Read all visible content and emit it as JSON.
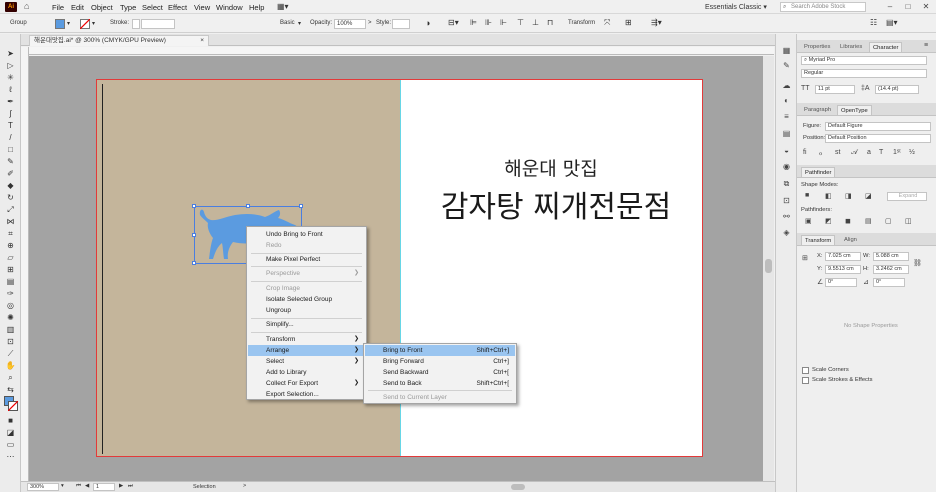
{
  "menubar": {
    "logo": "Ai",
    "items": [
      "File",
      "Edit",
      "Object",
      "Type",
      "Select",
      "Effect",
      "View",
      "Window",
      "Help"
    ],
    "workspace": "Essentials Classic",
    "stock_search_placeholder": "Search Adobe Stock"
  },
  "control_bar": {
    "selection_label": "Group",
    "stroke_label": "Stroke:",
    "brush_label": "Basic",
    "opacity_label": "Opacity:",
    "opacity_value": "100%",
    "style_label": "Style:",
    "transform_label": "Transform"
  },
  "document_tab": {
    "title": "해운대맛집.ai* @ 300% (CMYK/GPU Preview)",
    "close": "×"
  },
  "artwork": {
    "title_small": "해운대 맛집",
    "title_large": "감자탕 찌개전문점"
  },
  "colors": {
    "left_page": "#c4b59b",
    "bull": "#5b9be0",
    "guide": "#67d6e6",
    "artboard_border": "#e23a3a",
    "menu_highlight": "#9ac5f0"
  },
  "context_menu": {
    "items": [
      {
        "label": "Undo Bring to Front",
        "enabled": true
      },
      {
        "label": "Redo",
        "enabled": false
      },
      {
        "label": "Make Pixel Perfect",
        "enabled": true
      },
      {
        "label": "Perspective",
        "enabled": false,
        "submenu": true
      },
      {
        "label": "Crop Image",
        "enabled": false
      },
      {
        "label": "Isolate Selected Group",
        "enabled": true
      },
      {
        "label": "Ungroup",
        "enabled": true
      },
      {
        "label": "Simplify...",
        "enabled": true
      },
      {
        "label": "Transform",
        "enabled": true,
        "submenu": true
      },
      {
        "label": "Arrange",
        "enabled": true,
        "submenu": true,
        "highlighted": true
      },
      {
        "label": "Select",
        "enabled": true,
        "submenu": true
      },
      {
        "label": "Add to Library",
        "enabled": true
      },
      {
        "label": "Collect For Export",
        "enabled": true,
        "submenu": true
      },
      {
        "label": "Export Selection...",
        "enabled": true
      }
    ]
  },
  "arrange_submenu": {
    "items": [
      {
        "label": "Bring to Front",
        "shortcut": "Shift+Ctrl+]",
        "highlighted": true
      },
      {
        "label": "Bring Forward",
        "shortcut": "Ctrl+]"
      },
      {
        "label": "Send Backward",
        "shortcut": "Ctrl+["
      },
      {
        "label": "Send to Back",
        "shortcut": "Shift+Ctrl+["
      },
      {
        "label": "Send to Current Layer",
        "shortcut": "",
        "enabled": false
      }
    ]
  },
  "status_bar": {
    "zoom": "300%",
    "artboard_num": "1",
    "tool_name": "Selection"
  },
  "panels": {
    "top_tabs": [
      "Properties",
      "Libraries",
      "Character"
    ],
    "font_family": "Myriad Pro",
    "font_style": "Regular",
    "font_size": "11 pt",
    "leading": "(14.4 pt)",
    "mid_tabs": [
      "Paragraph",
      "OpenType"
    ],
    "figure_label": "Figure:",
    "figure_value": "Default Figure",
    "position_label": "Position:",
    "position_value": "Default Position",
    "pathfinder_tab": "Pathfinder",
    "shape_modes_label": "Shape Modes:",
    "expand_label": "Expand",
    "pathfinders_label": "Pathfinders:",
    "transform_tabs": [
      "Transform",
      "Align"
    ],
    "x_label": "X:",
    "x_value": "7.025 cm",
    "y_label": "Y:",
    "y_value": "9.5513 cm",
    "w_label": "W:",
    "w_value": "5.088 cm",
    "h_label": "H:",
    "h_value": "3.2462 cm",
    "angle_value": "0°",
    "shear_value": "0°",
    "no_shape_props": "No Shape Properties",
    "scale_corners": "Scale Corners",
    "scale_strokes": "Scale Strokes & Effects"
  }
}
